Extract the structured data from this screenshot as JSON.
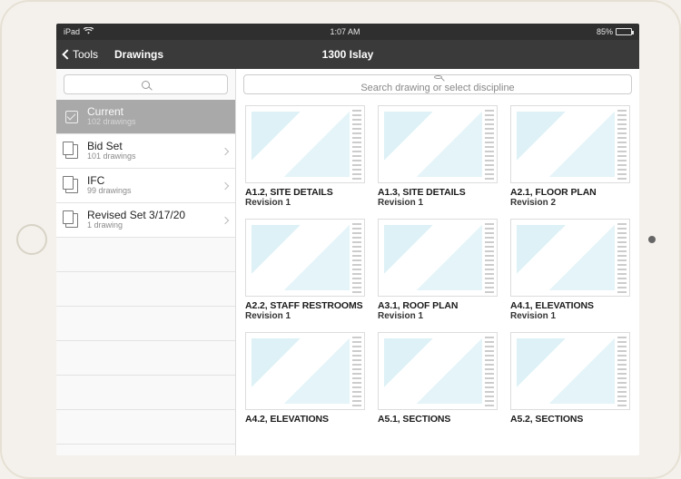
{
  "statusbar": {
    "device": "iPad",
    "wifi": "wifi-icon",
    "time": "1:07 AM",
    "battery_pct": "85%"
  },
  "navbar": {
    "back_label": "Tools",
    "section": "Drawings",
    "project": "1300 Islay"
  },
  "sidebar": {
    "search_placeholder": "",
    "items": [
      {
        "title": "Current",
        "sub": "102 drawings",
        "selected": true,
        "icon": "check"
      },
      {
        "title": "Bid Set",
        "sub": "101 drawings",
        "selected": false,
        "icon": "docs"
      },
      {
        "title": "IFC",
        "sub": "99 drawings",
        "selected": false,
        "icon": "docs"
      },
      {
        "title": "Revised Set 3/17/20",
        "sub": "1 drawing",
        "selected": false,
        "icon": "docs"
      }
    ]
  },
  "main": {
    "search_placeholder": "Search drawing or select discipline",
    "cards": [
      {
        "title": "A1.2, SITE DETAILS",
        "rev": "Revision 1"
      },
      {
        "title": "A1.3, SITE DETAILS",
        "rev": "Revision 1"
      },
      {
        "title": "A2.1, FLOOR PLAN",
        "rev": "Revision 2"
      },
      {
        "title": "A2.2, STAFF RESTROOMS",
        "rev": "Revision 1"
      },
      {
        "title": "A3.1, ROOF PLAN",
        "rev": "Revision 1"
      },
      {
        "title": "A4.1, ELEVATIONS",
        "rev": "Revision 1"
      },
      {
        "title": "A4.2, ELEVATIONS",
        "rev": ""
      },
      {
        "title": "A5.1, SECTIONS",
        "rev": ""
      },
      {
        "title": "A5.2, SECTIONS",
        "rev": ""
      }
    ]
  }
}
